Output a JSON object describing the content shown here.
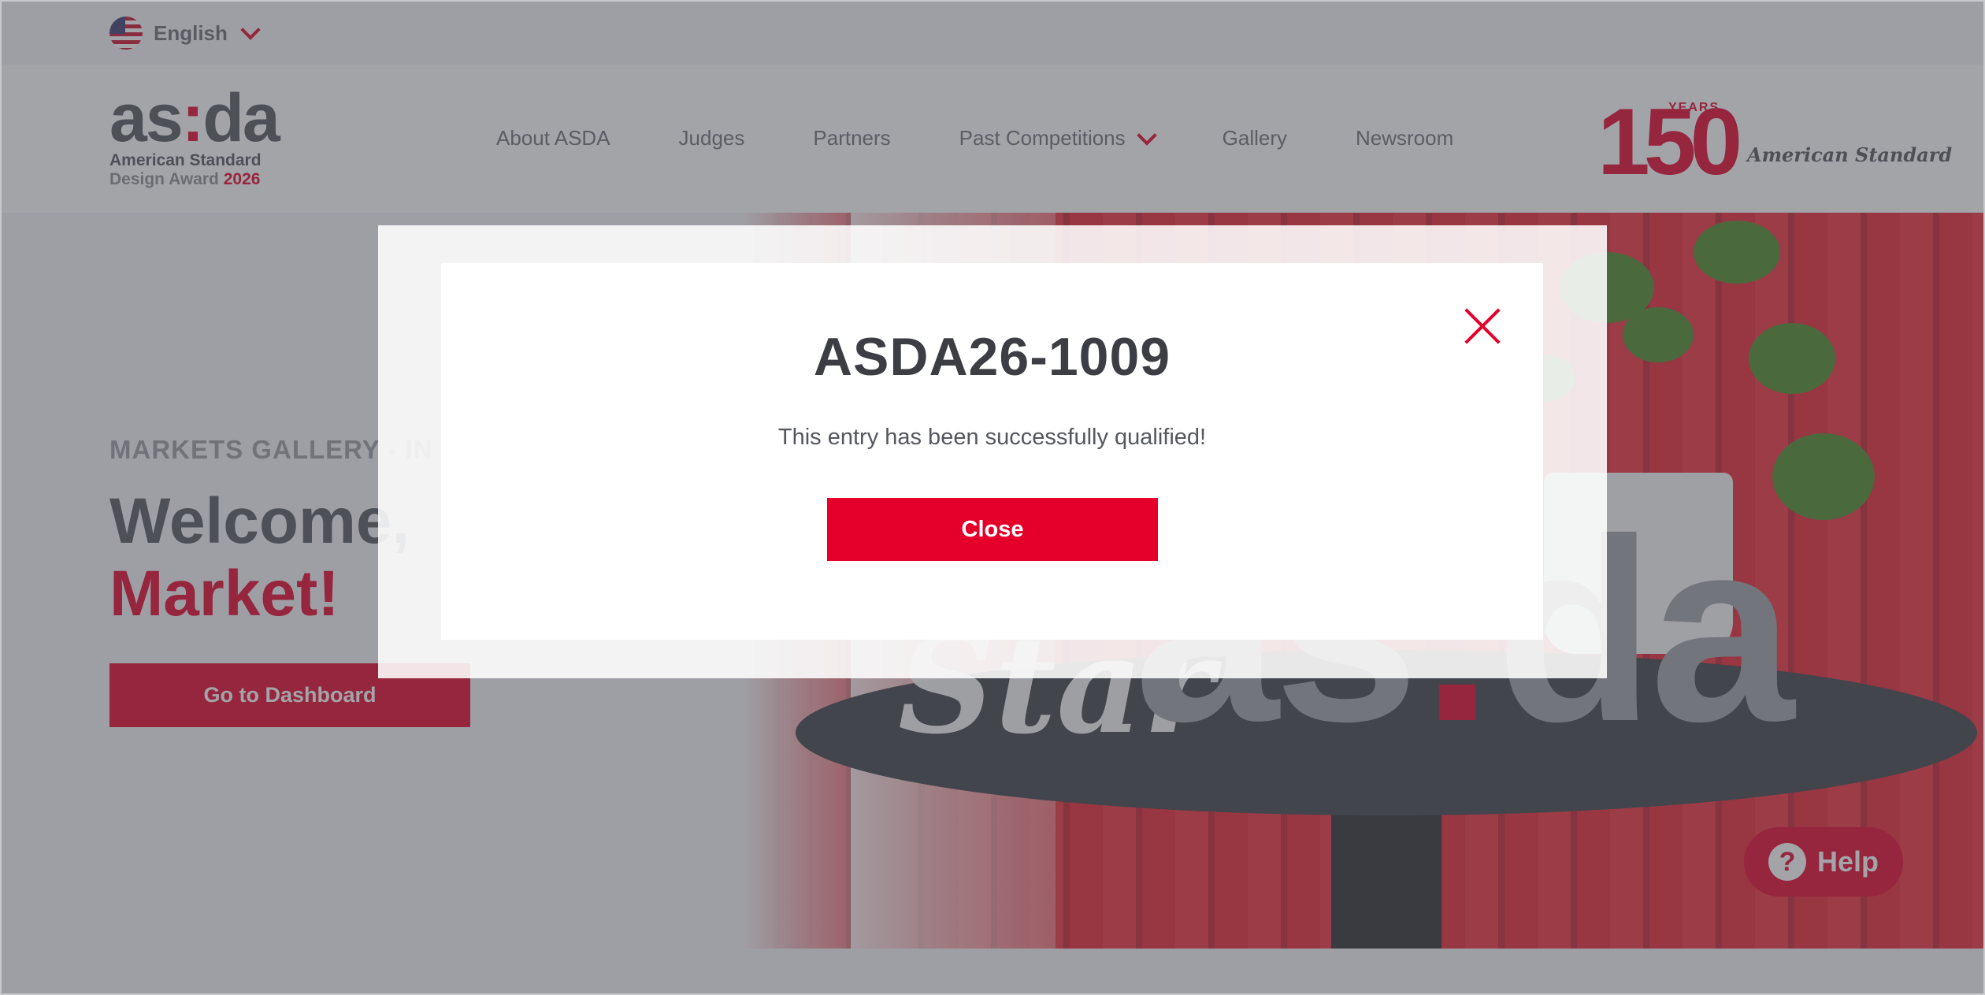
{
  "language": {
    "label": "English",
    "icon": "us-flag-icon"
  },
  "logo": {
    "mark_left": "as",
    "mark_colon": ":",
    "mark_right": "da",
    "line1": "American Standard",
    "line2": "Design Award",
    "year": "2026"
  },
  "nav": {
    "items": [
      {
        "label": "About ASDA"
      },
      {
        "label": "Judges"
      },
      {
        "label": "Partners"
      },
      {
        "label": "Past Competitions"
      },
      {
        "label": "Gallery"
      },
      {
        "label": "Newsroom"
      }
    ]
  },
  "brand": {
    "number": "150",
    "years": "YEARS",
    "name": "American Standard"
  },
  "hero": {
    "eyebrow": "MARKETS GALLERY - IN",
    "title_line1": "Welcome,",
    "title_line2": "Market!",
    "cta": "Go to Dashboard",
    "sign_left": "as",
    "sign_colon": ":",
    "sign_right": "da",
    "script": "Star"
  },
  "help": {
    "label": "Help",
    "icon_glyph": "?"
  },
  "modal": {
    "title": "ASDA26-1009",
    "message": "This entry has been successfully qualified!",
    "button": "Close"
  },
  "colors": {
    "accent": "#e4002b",
    "text_dark": "#55575e",
    "overlay": "#484a52"
  }
}
